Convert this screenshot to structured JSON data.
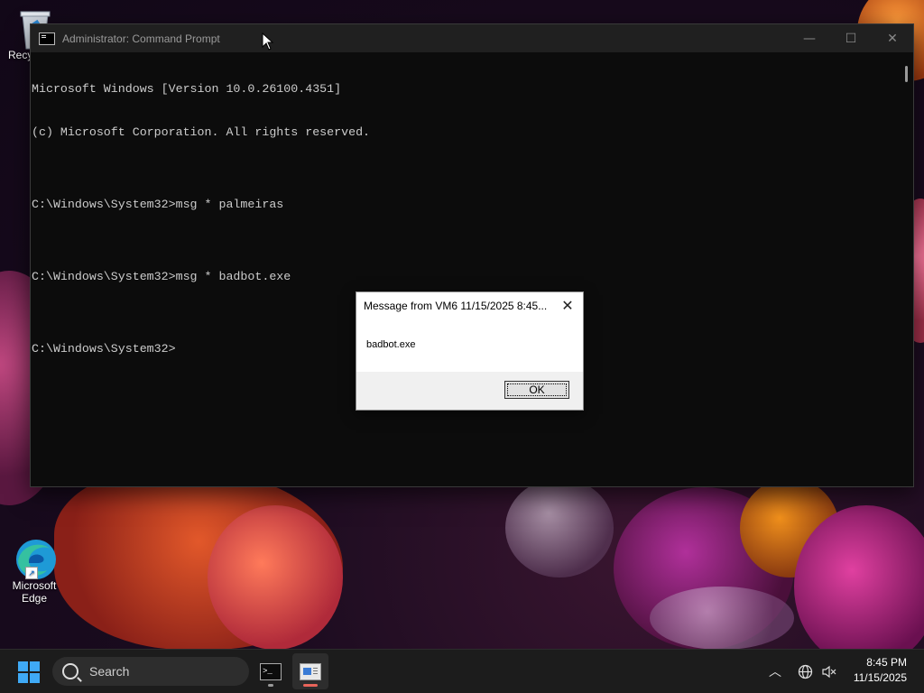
{
  "desktop": {
    "icons": [
      {
        "label": "Recycle Bin",
        "visible_label": "Recy"
      },
      {
        "label": "Microsoft Edge"
      }
    ]
  },
  "cmd_window": {
    "title": "Administrator: Command Prompt",
    "lines": [
      "Microsoft Windows [Version 10.0.26100.4351]",
      "(c) Microsoft Corporation. All rights reserved.",
      "",
      "C:\\Windows\\System32>msg * palmeiras",
      "",
      "C:\\Windows\\System32>msg * badbot.exe",
      "",
      "C:\\Windows\\System32>"
    ],
    "controls": {
      "minimize": "—",
      "maximize": "☐",
      "close": "✕"
    }
  },
  "message_box": {
    "title": "Message from VM6 11/15/2025 8:45...",
    "message": "badbot.exe",
    "ok_label": "OK",
    "close_glyph": "✕"
  },
  "taskbar": {
    "search_label": "Search",
    "clock_time": "8:45 PM",
    "clock_date": "11/15/2025",
    "accent_color": "#3fa9f5"
  }
}
